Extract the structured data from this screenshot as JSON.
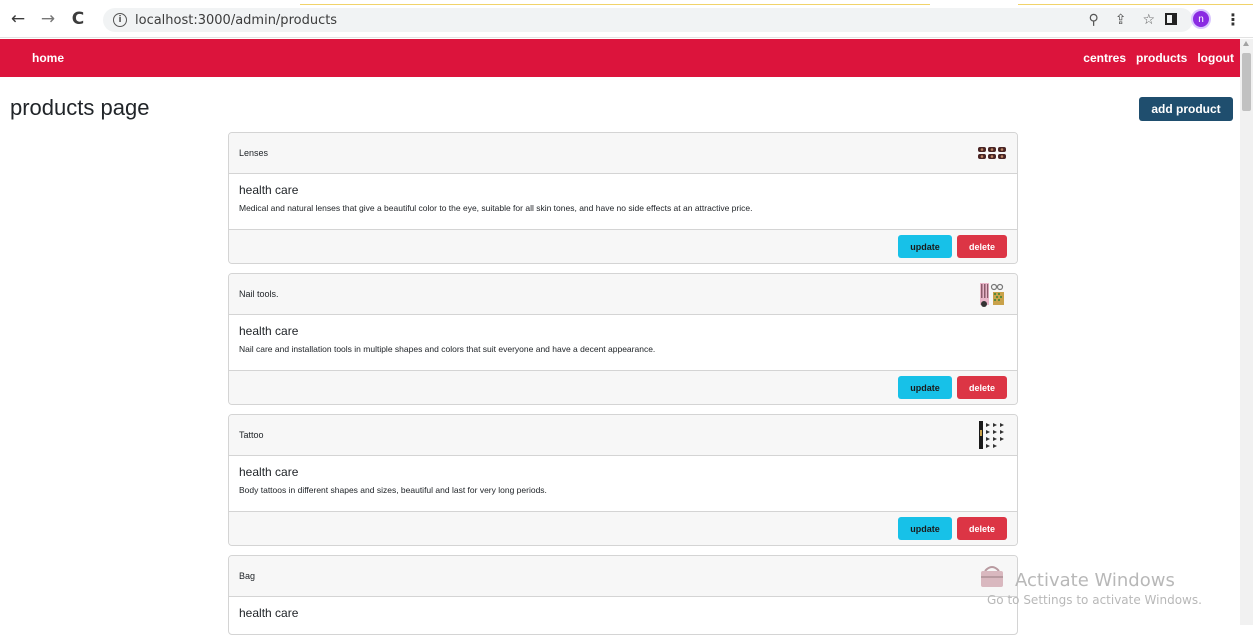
{
  "browser": {
    "url": "localhost:3000/admin/products",
    "avatar_letter": "n",
    "back_icon": "←",
    "forward_icon": "→",
    "reload_icon": "C",
    "info_icon": "i",
    "zoom_icon": "⚲",
    "share_icon": "⇪",
    "star_icon": "☆",
    "menu_icon": "⋮"
  },
  "navbar": {
    "home": "home",
    "links": [
      "centres",
      "products",
      "logout"
    ]
  },
  "page": {
    "title": "products page",
    "add_button": "add product"
  },
  "products": [
    {
      "name": "Lenses",
      "category": "health care",
      "description": "Medical and natural lenses that give a beautiful color to the eye, suitable for all skin tones, and have no side effects at an attractive price.",
      "update_label": "update",
      "delete_label": "delete"
    },
    {
      "name": "Nail tools.",
      "category": "health care",
      "description": "Nail care and installation tools in multiple shapes and colors that suit everyone and have a decent appearance.",
      "update_label": "update",
      "delete_label": "delete"
    },
    {
      "name": "Tattoo",
      "category": "health care",
      "description": "Body tattoos in different shapes and sizes, beautiful and last for very long periods.",
      "update_label": "update",
      "delete_label": "delete"
    },
    {
      "name": "Bag",
      "category": "health care"
    }
  ],
  "watermark": {
    "line1": "Activate Windows",
    "line2": "Go to Settings to activate Windows."
  }
}
